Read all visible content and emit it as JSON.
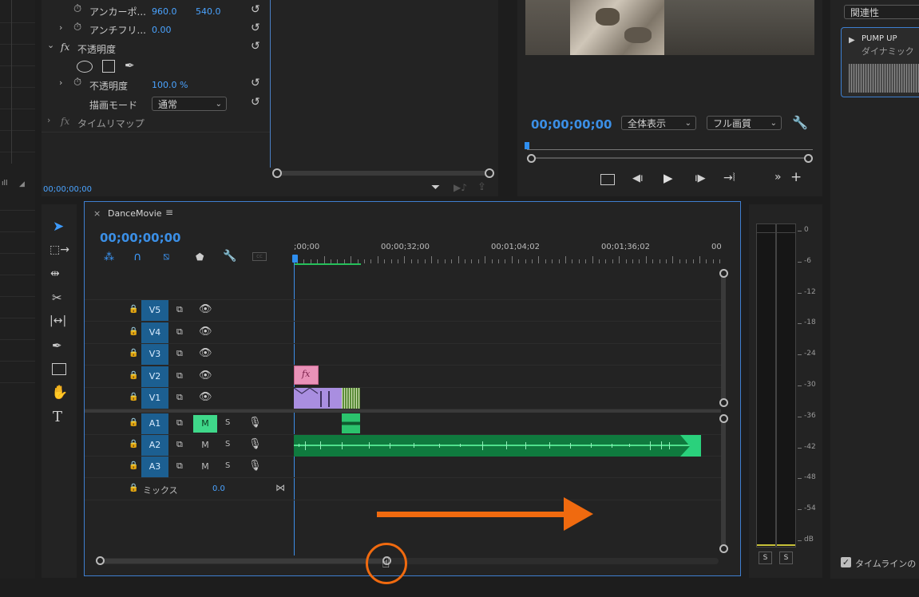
{
  "effect_controls": {
    "anchor_label": "アンカーポ...",
    "anchor_x": "960.0",
    "anchor_y": "540.0",
    "antiflicker_label": "アンチフリ...",
    "antiflicker_value": "0.00",
    "opacity_section": "不透明度",
    "fx_symbol": "fx",
    "opacity_label": "不透明度",
    "opacity_value": "100.0 %",
    "blend_mode_label": "描画モード",
    "blend_mode_value": "通常",
    "time_remap_label": "タイムリマップ",
    "timecode": "00;00;00;00"
  },
  "program_monitor": {
    "timecode": "00;00;00;00",
    "fit_dropdown": "全体表示",
    "quality_dropdown": "フル画質"
  },
  "right_panel": {
    "dropdown": "関連性",
    "clip_title": "PUMP UP",
    "clip_subtitle": "ダイナミック",
    "timeline_checkbox_label": "タイムラインの"
  },
  "timeline": {
    "tab_name": "DanceMovie",
    "close_glyph": "×",
    "menu_glyph": "≡",
    "timecode": "00;00;00;00",
    "ruler_labels": [
      ";00;00",
      "00;00;32;00",
      "00;01;04;02",
      "00;01;36;02",
      "00"
    ],
    "video_tracks": [
      "V5",
      "V4",
      "V3",
      "V2",
      "V1"
    ],
    "audio_tracks": [
      {
        "name": "A1",
        "m": "M",
        "s": "S",
        "muted": true
      },
      {
        "name": "A2",
        "m": "M",
        "s": "S",
        "muted": false
      },
      {
        "name": "A3",
        "m": "M",
        "s": "S",
        "muted": false
      }
    ],
    "mix_label": "ミックス",
    "mix_value": "0.0",
    "fx_badge": "fx"
  },
  "audio_meter": {
    "labels": [
      "0",
      "-6",
      "-12",
      "-18",
      "-24",
      "-30",
      "-36",
      "-42",
      "-48",
      "-54",
      "dB"
    ],
    "solo_left": "S",
    "solo_right": "S"
  },
  "colors": {
    "accent": "#4aa3ff",
    "track_blue": "#1c5f91",
    "audio_green": "#1fae6a",
    "video_purple": "#a98ee0",
    "annotation_orange": "#f06a0f"
  }
}
